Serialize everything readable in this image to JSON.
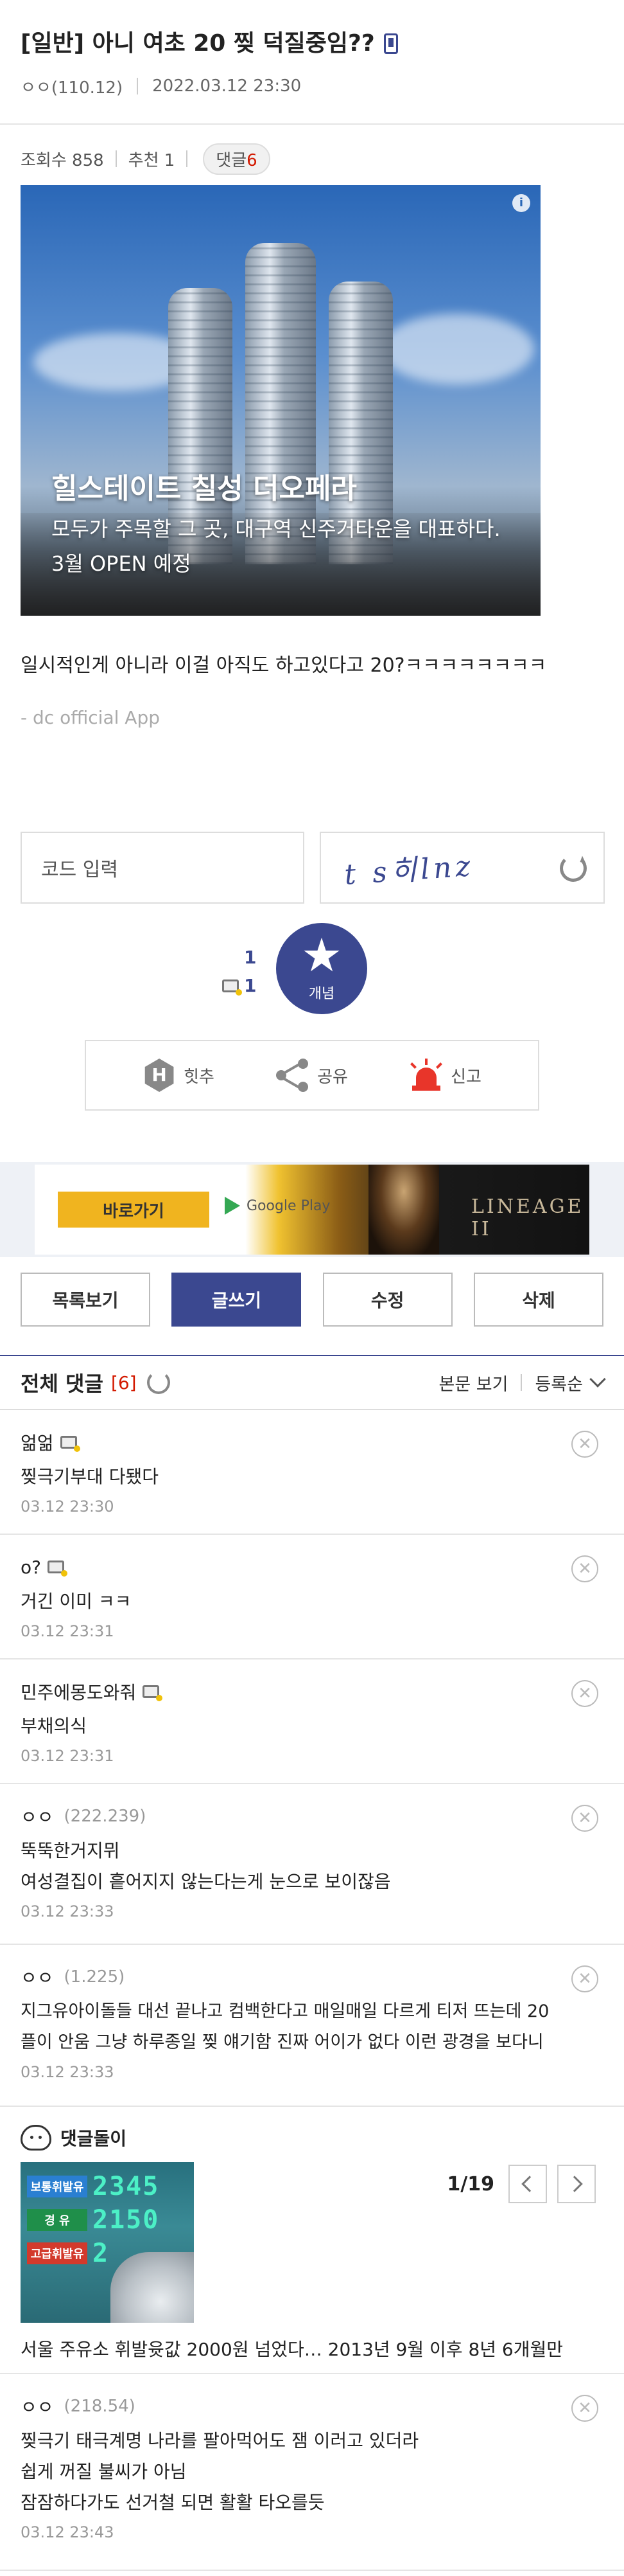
{
  "post": {
    "title": "[일반] 아니 여초 20 찢 덕질중임??",
    "author": "ㅇㅇ(110.12)",
    "datetime": "2022.03.12 23:30",
    "views_label": "조회수 858",
    "recommend_label": "추천 1",
    "comment_badge_label": "댓글",
    "comment_badge_count": "6",
    "body": "일시적인게 아니라 이걸 아직도 하고있다고 20?ㅋㅋㅋㅋㅋㅋㅋㅋ",
    "signature": "- dc official App"
  },
  "ad": {
    "headline": "힐스테이트 칠성 더오페라",
    "subtext": "모두가 주목할 그 곳, 대구역 신주거타운을 대표하다. 3월 OPEN 예정",
    "info": "i"
  },
  "captcha": {
    "input_placeholder": "코드 입력",
    "image_text": "t s히lnz"
  },
  "recommend": {
    "up_count": "1",
    "fixed_count": "1",
    "button_label": "개념"
  },
  "actions": {
    "hit_icon_letter": "H",
    "hit_label": "힛추",
    "share_label": "공유",
    "report_label": "신고"
  },
  "google_ad": {
    "go_label": "바로가기",
    "store_label": "Google Play",
    "game_logo": "LINEAGE II"
  },
  "buttons": {
    "list": "목록보기",
    "write": "글쓰기",
    "edit": "수정",
    "delete": "삭제"
  },
  "comments_header": {
    "title": "전체 댓글",
    "count": "[6]",
    "view_body": "본문 보기",
    "sort": "등록순"
  },
  "comments": [
    {
      "name": "얾얾",
      "ip": "",
      "text": "찢극기부대 다됐다",
      "date": "03.12 23:30"
    },
    {
      "name": "o?",
      "ip": "",
      "text": "거긴 이미 ㅋㅋ",
      "date": "03.12 23:31"
    },
    {
      "name": "민주에몽도와줘",
      "ip": "",
      "text": "부채의식",
      "date": "03.12 23:31"
    },
    {
      "name": "ㅇㅇ",
      "ip": "(222.239)",
      "text_lines": [
        "뚝뚝한거지뮈",
        "여성결집이 흩어지지 않는다는게 눈으로 보이잖음"
      ],
      "date": "03.12 23:33"
    },
    {
      "name": "ㅇㅇ",
      "ip": "(1.225)",
      "text_lines": [
        "지그유아이돌들 대선 끝나고 컴백한다고 매일매일 다르게 티저 뜨는데 20",
        "플이 안움 그냥 하루종일 찢 얘기함 진짜 어이가 없다 이런 광경을 보다니"
      ],
      "date": "03.12 23:33"
    },
    {
      "name": "ㅇㅇ",
      "ip": "(218.54)",
      "text_lines": [
        "찢극기 태극계명 나라를 팔아먹어도 잼 이러고 있더라",
        "쉽게 꺼질 불씨가 아님",
        "잠잠하다가도 선거철 되면 활활 타오를듯"
      ],
      "date": "03.12 23:43"
    }
  ],
  "comment_bot": {
    "label": "댓글돌이",
    "pager": "1/19",
    "thumb_tags": [
      "보통휘발유",
      "경  유",
      "고급휘발유"
    ],
    "thumb_prices": [
      "2345",
      "2150",
      "2"
    ],
    "title": "서울 주유소 휘발윳값 2000원 넘었다… 2013년 9월 이후 8년 6개월만"
  },
  "colors": {
    "accent": "#3b4890",
    "red": "#d31900",
    "ad_button": "#f0b41f"
  }
}
